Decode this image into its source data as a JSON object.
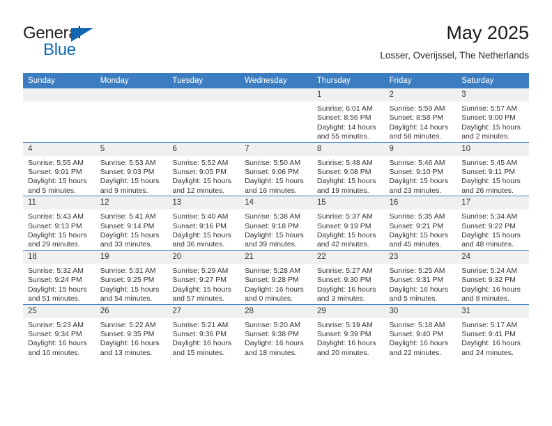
{
  "logo": {
    "word_top": "General",
    "word_bottom": "Blue",
    "triangle_icon": "triangle-icon",
    "brand_color": "#1268b3",
    "text_color": "#231f20"
  },
  "header": {
    "title": "May 2025",
    "subtitle": "Losser, Overijssel, The Netherlands"
  },
  "theme": {
    "header_blue": "#3b7dc0",
    "daynum_band": "#f0f0f0",
    "text": "#333333"
  },
  "calendar": {
    "columns": [
      "Sunday",
      "Monday",
      "Tuesday",
      "Wednesday",
      "Thursday",
      "Friday",
      "Saturday"
    ],
    "weeks": [
      [
        {
          "day": "",
          "blank": true
        },
        {
          "day": "",
          "blank": true
        },
        {
          "day": "",
          "blank": true
        },
        {
          "day": "",
          "blank": true
        },
        {
          "day": "1",
          "sunrise": "Sunrise: 6:01 AM",
          "sunset": "Sunset: 8:56 PM",
          "daylight": "Daylight: 14 hours and 55 minutes."
        },
        {
          "day": "2",
          "sunrise": "Sunrise: 5:59 AM",
          "sunset": "Sunset: 8:58 PM",
          "daylight": "Daylight: 14 hours and 58 minutes."
        },
        {
          "day": "3",
          "sunrise": "Sunrise: 5:57 AM",
          "sunset": "Sunset: 9:00 PM",
          "daylight": "Daylight: 15 hours and 2 minutes."
        }
      ],
      [
        {
          "day": "4",
          "sunrise": "Sunrise: 5:55 AM",
          "sunset": "Sunset: 9:01 PM",
          "daylight": "Daylight: 15 hours and 5 minutes."
        },
        {
          "day": "5",
          "sunrise": "Sunrise: 5:53 AM",
          "sunset": "Sunset: 9:03 PM",
          "daylight": "Daylight: 15 hours and 9 minutes."
        },
        {
          "day": "6",
          "sunrise": "Sunrise: 5:52 AM",
          "sunset": "Sunset: 9:05 PM",
          "daylight": "Daylight: 15 hours and 12 minutes."
        },
        {
          "day": "7",
          "sunrise": "Sunrise: 5:50 AM",
          "sunset": "Sunset: 9:06 PM",
          "daylight": "Daylight: 15 hours and 16 minutes."
        },
        {
          "day": "8",
          "sunrise": "Sunrise: 5:48 AM",
          "sunset": "Sunset: 9:08 PM",
          "daylight": "Daylight: 15 hours and 19 minutes."
        },
        {
          "day": "9",
          "sunrise": "Sunrise: 5:46 AM",
          "sunset": "Sunset: 9:10 PM",
          "daylight": "Daylight: 15 hours and 23 minutes."
        },
        {
          "day": "10",
          "sunrise": "Sunrise: 5:45 AM",
          "sunset": "Sunset: 9:11 PM",
          "daylight": "Daylight: 15 hours and 26 minutes."
        }
      ],
      [
        {
          "day": "11",
          "sunrise": "Sunrise: 5:43 AM",
          "sunset": "Sunset: 9:13 PM",
          "daylight": "Daylight: 15 hours and 29 minutes."
        },
        {
          "day": "12",
          "sunrise": "Sunrise: 5:41 AM",
          "sunset": "Sunset: 9:14 PM",
          "daylight": "Daylight: 15 hours and 33 minutes."
        },
        {
          "day": "13",
          "sunrise": "Sunrise: 5:40 AM",
          "sunset": "Sunset: 9:16 PM",
          "daylight": "Daylight: 15 hours and 36 minutes."
        },
        {
          "day": "14",
          "sunrise": "Sunrise: 5:38 AM",
          "sunset": "Sunset: 9:18 PM",
          "daylight": "Daylight: 15 hours and 39 minutes."
        },
        {
          "day": "15",
          "sunrise": "Sunrise: 5:37 AM",
          "sunset": "Sunset: 9:19 PM",
          "daylight": "Daylight: 15 hours and 42 minutes."
        },
        {
          "day": "16",
          "sunrise": "Sunrise: 5:35 AM",
          "sunset": "Sunset: 9:21 PM",
          "daylight": "Daylight: 15 hours and 45 minutes."
        },
        {
          "day": "17",
          "sunrise": "Sunrise: 5:34 AM",
          "sunset": "Sunset: 9:22 PM",
          "daylight": "Daylight: 15 hours and 48 minutes."
        }
      ],
      [
        {
          "day": "18",
          "sunrise": "Sunrise: 5:32 AM",
          "sunset": "Sunset: 9:24 PM",
          "daylight": "Daylight: 15 hours and 51 minutes."
        },
        {
          "day": "19",
          "sunrise": "Sunrise: 5:31 AM",
          "sunset": "Sunset: 9:25 PM",
          "daylight": "Daylight: 15 hours and 54 minutes."
        },
        {
          "day": "20",
          "sunrise": "Sunrise: 5:29 AM",
          "sunset": "Sunset: 9:27 PM",
          "daylight": "Daylight: 15 hours and 57 minutes."
        },
        {
          "day": "21",
          "sunrise": "Sunrise: 5:28 AM",
          "sunset": "Sunset: 9:28 PM",
          "daylight": "Daylight: 16 hours and 0 minutes."
        },
        {
          "day": "22",
          "sunrise": "Sunrise: 5:27 AM",
          "sunset": "Sunset: 9:30 PM",
          "daylight": "Daylight: 16 hours and 3 minutes."
        },
        {
          "day": "23",
          "sunrise": "Sunrise: 5:25 AM",
          "sunset": "Sunset: 9:31 PM",
          "daylight": "Daylight: 16 hours and 5 minutes."
        },
        {
          "day": "24",
          "sunrise": "Sunrise: 5:24 AM",
          "sunset": "Sunset: 9:32 PM",
          "daylight": "Daylight: 16 hours and 8 minutes."
        }
      ],
      [
        {
          "day": "25",
          "sunrise": "Sunrise: 5:23 AM",
          "sunset": "Sunset: 9:34 PM",
          "daylight": "Daylight: 16 hours and 10 minutes."
        },
        {
          "day": "26",
          "sunrise": "Sunrise: 5:22 AM",
          "sunset": "Sunset: 9:35 PM",
          "daylight": "Daylight: 16 hours and 13 minutes."
        },
        {
          "day": "27",
          "sunrise": "Sunrise: 5:21 AM",
          "sunset": "Sunset: 9:36 PM",
          "daylight": "Daylight: 16 hours and 15 minutes."
        },
        {
          "day": "28",
          "sunrise": "Sunrise: 5:20 AM",
          "sunset": "Sunset: 9:38 PM",
          "daylight": "Daylight: 16 hours and 18 minutes."
        },
        {
          "day": "29",
          "sunrise": "Sunrise: 5:19 AM",
          "sunset": "Sunset: 9:39 PM",
          "daylight": "Daylight: 16 hours and 20 minutes."
        },
        {
          "day": "30",
          "sunrise": "Sunrise: 5:18 AM",
          "sunset": "Sunset: 9:40 PM",
          "daylight": "Daylight: 16 hours and 22 minutes."
        },
        {
          "day": "31",
          "sunrise": "Sunrise: 5:17 AM",
          "sunset": "Sunset: 9:41 PM",
          "daylight": "Daylight: 16 hours and 24 minutes."
        }
      ]
    ]
  }
}
